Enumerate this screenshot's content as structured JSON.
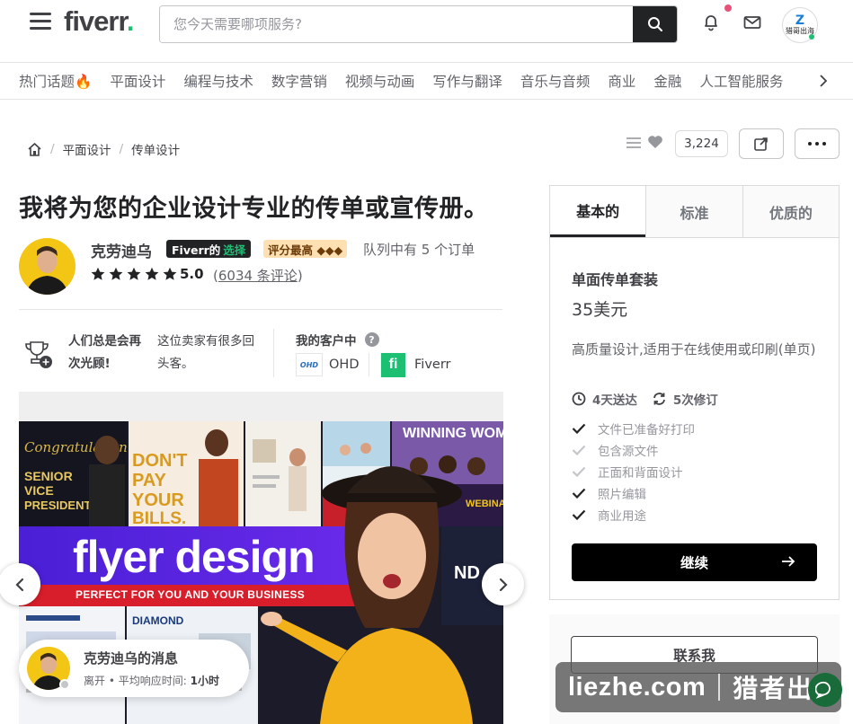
{
  "header": {
    "logo_text": "fiverr",
    "logo_dot": ".",
    "search_placeholder": "您今天需要哪项服务?",
    "avatar_text": "猎哥出海"
  },
  "categories": [
    "热门话题🔥",
    "平面设计",
    "编程与技术",
    "数字营销",
    "视频与动画",
    "写作与翻译",
    "音乐与音频",
    "商业",
    "金融",
    "人工智能服务"
  ],
  "breadcrumb": {
    "items": [
      "平面设计",
      "传单设计"
    ],
    "like_count": "3,224"
  },
  "gig": {
    "title": "我将为您的企业设计专业的传单或宣传册。",
    "seller_name": "克劳迪乌",
    "choice_badge": "Fiverr的",
    "choice_badge_accent": "选择",
    "top_rated": "评分最高 ◆◆◆",
    "queue": "队列中有 5 个订单",
    "rating": "5.0",
    "review_prefix": "(",
    "review_count": "6034 条评论",
    "review_suffix": ")"
  },
  "highlights": {
    "title": "人们总是会再次光顾!",
    "desc": "这位卖家有很多回头客。",
    "clients_label": "我的客户中",
    "clients": [
      {
        "logo": "OHD",
        "name": "OHD"
      },
      {
        "logo": "fi",
        "name": "Fiverr"
      }
    ]
  },
  "gallery": {
    "flyer_headline": "flyer design",
    "flyer_tagline": "PERFECT FOR YOU AND YOUR BUSINESS"
  },
  "message": {
    "title": "克劳迪乌的消息",
    "status": "离开",
    "sep": "•",
    "response_label": "平均响应时间:",
    "response_time": "1小时"
  },
  "package": {
    "tabs": [
      "基本的",
      "标准",
      "优质的"
    ],
    "active_tab": 0,
    "name": "单面传单套装",
    "price": "35美元",
    "description": "高质量设计,适用于在线使用或印刷(单页)",
    "delivery": "4天送达",
    "revisions": "5次修订",
    "features": [
      {
        "label": "文件已准备好打印",
        "included": true
      },
      {
        "label": "包含源文件",
        "included": false
      },
      {
        "label": "正面和背面设计",
        "included": false
      },
      {
        "label": "照片编辑",
        "included": true
      },
      {
        "label": "商业用途",
        "included": true
      }
    ],
    "continue_label": "继续",
    "contact_label": "联系我"
  },
  "watermark": {
    "latin": "liezhe.com",
    "cn": "猎者出海"
  },
  "colors": {
    "brand_green": "#1dbf73",
    "dark": "#222325",
    "flyer_purple": "#4a1fd6",
    "flyer_red": "#d81e2b",
    "avatar_yellow": "#f3c515"
  }
}
